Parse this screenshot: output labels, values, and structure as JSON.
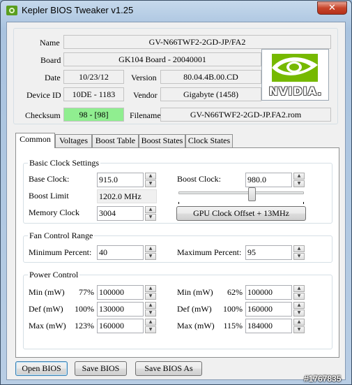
{
  "window": {
    "title": "Kepler BIOS Tweaker v1.25",
    "close_label": "✕"
  },
  "info": {
    "name_label": "Name",
    "name_value": "GV-N66TWF2-2GD-JP/FA2",
    "board_label": "Board",
    "board_value": "GK104 Board - 20040001",
    "date_label": "Date",
    "date_value": "10/23/12",
    "version_label": "Version",
    "version_value": "80.04.4B.00.CD",
    "device_label": "Device ID",
    "device_value": "10DE - 1183",
    "vendor_label": "Vendor",
    "vendor_value": "Gigabyte (1458)",
    "checksum_label": "Checksum",
    "checksum_value": "98 - [98]",
    "filename_label": "Filename",
    "filename_value": "GV-N66TWF2-2GD-JP.FA2.rom",
    "logo_text": "NVIDIA."
  },
  "tabs": [
    "Common",
    "Voltages",
    "Boost Table",
    "Boost States",
    "Clock States"
  ],
  "clock": {
    "title": "Basic Clock Settings",
    "base_label": "Base Clock:",
    "base_value": "915.0",
    "boost_label": "Boost Clock:",
    "boost_value": "980.0",
    "boost_limit_label": "Boost Limit",
    "boost_limit_value": "1202.0 MHz",
    "memory_label": "Memory Clock",
    "memory_value": "3004",
    "offset_button": "GPU Clock Offset + 13MHz",
    "slider_fraction": 0.59
  },
  "fan": {
    "title": "Fan Control Range",
    "min_label": "Minimum Percent:",
    "min_value": "40",
    "max_label": "Maximum Percent:",
    "max_value": "95"
  },
  "power": {
    "title": "Power Control",
    "left": [
      {
        "label": "Min (mW)",
        "pct": "77%",
        "value": "100000"
      },
      {
        "label": "Def (mW)",
        "pct": "100%",
        "value": "130000"
      },
      {
        "label": "Max (mW)",
        "pct": "123%",
        "value": "160000"
      }
    ],
    "right": [
      {
        "label": "Min (mW)",
        "pct": "62%",
        "value": "100000"
      },
      {
        "label": "Def (mW)",
        "pct": "100%",
        "value": "160000"
      },
      {
        "label": "Max (mW)",
        "pct": "115%",
        "value": "184000"
      }
    ]
  },
  "buttons": {
    "open": "Open BIOS",
    "save": "Save BIOS",
    "save_as": "Save BIOS As"
  },
  "watermark": "#1767835",
  "colors": {
    "checksum_ok": "#90ee90",
    "nvidia_green": "#76b900"
  }
}
